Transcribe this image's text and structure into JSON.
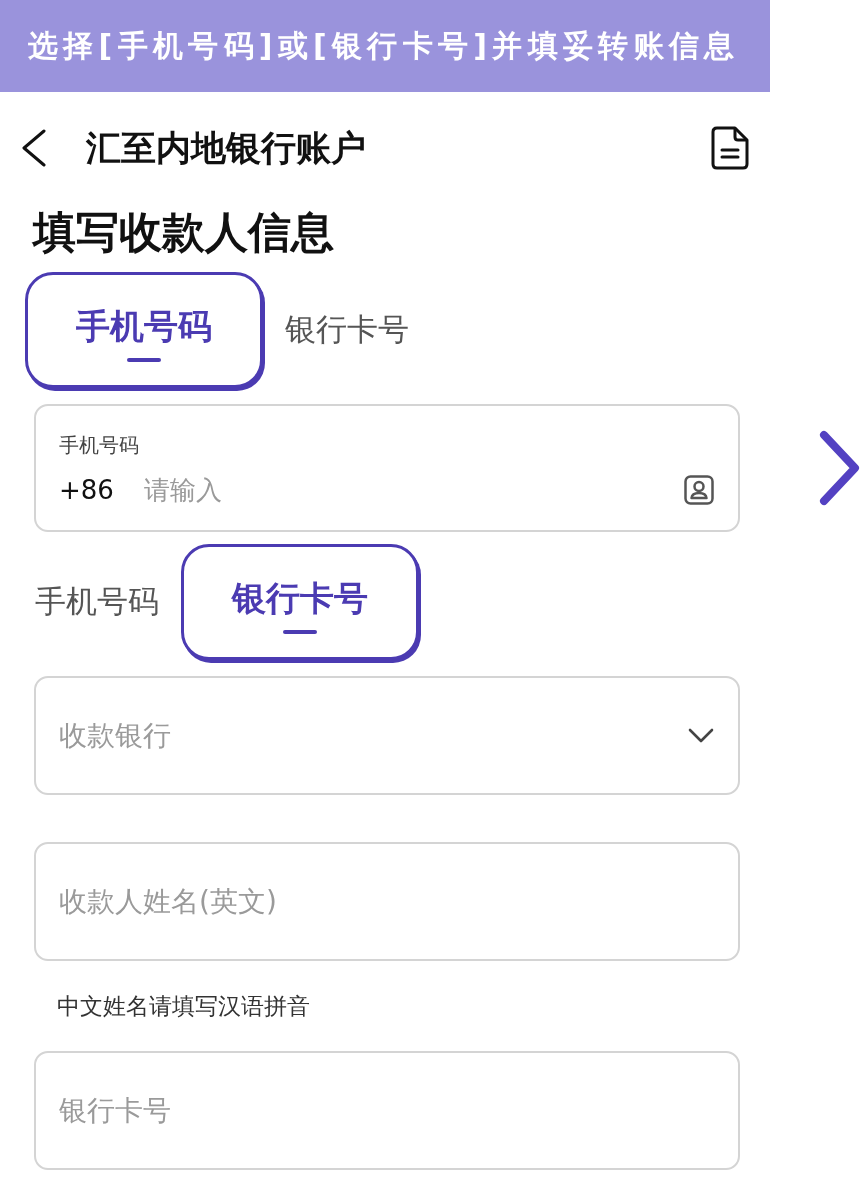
{
  "banner": {
    "text": "选择[手机号码]或[银行卡号]并填妥转账信息"
  },
  "header": {
    "title": "汇至内地银行账户"
  },
  "heading": "填写收款人信息",
  "sections": [
    {
      "tabs": [
        {
          "label": "手机号码",
          "selected": true
        },
        {
          "label": "银行卡号",
          "selected": false
        }
      ],
      "fields": [
        {
          "kind": "phone",
          "label": "手机号码",
          "prefix": "+86",
          "placeholder": "请输入"
        }
      ]
    },
    {
      "tabs": [
        {
          "label": "手机号码",
          "selected": false
        },
        {
          "label": "银行卡号",
          "selected": true
        }
      ],
      "fields": [
        {
          "kind": "select",
          "placeholder": "收款银行"
        },
        {
          "kind": "text",
          "placeholder": "收款人姓名(英文)",
          "hint": "中文姓名请填写汉语拼音"
        },
        {
          "kind": "text",
          "placeholder": "银行卡号"
        }
      ]
    }
  ]
}
